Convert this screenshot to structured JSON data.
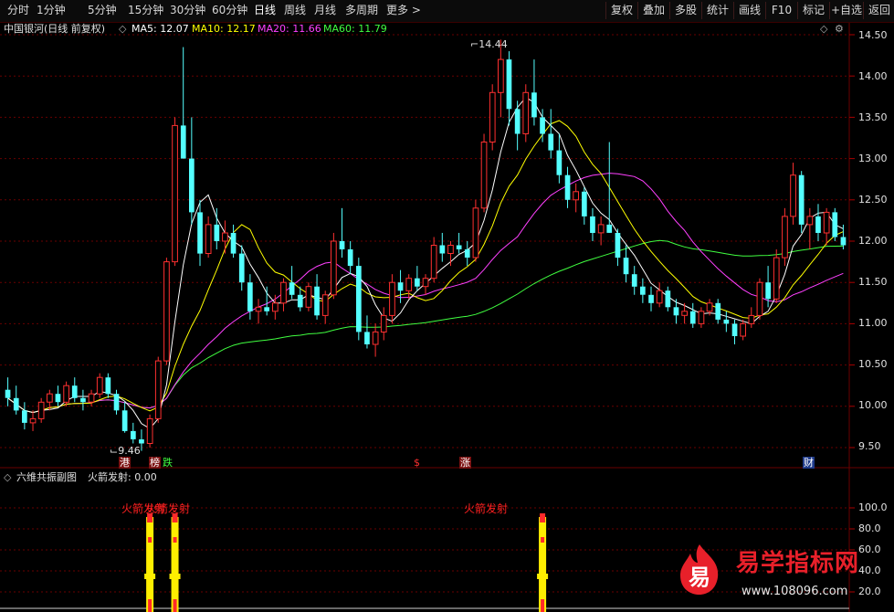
{
  "toolbar": {
    "periods": [
      "分时",
      "1分钟",
      "5分钟",
      "15分钟",
      "30分钟",
      "60分钟",
      "日线",
      "周线",
      "月线",
      "多周期",
      "更多"
    ],
    "active": "日线",
    "right": [
      "复权",
      "叠加",
      "多股",
      "统计",
      "画线",
      "F10",
      "标记",
      "+自选",
      "返回"
    ]
  },
  "main_legend": {
    "stock": "中国银河(日线 前复权)",
    "ma5": "MA5: 12.07",
    "ma10": "MA10: 12.17",
    "ma20": "MA20: 11.66",
    "ma60": "MA60: 11.79"
  },
  "colors": {
    "up": "#ff3030",
    "down": "#54ffff",
    "ma5": "#ffffff",
    "ma10": "#ffff00",
    "ma20": "#ff40ff",
    "ma60": "#40ff40",
    "grid": "#6a0000"
  },
  "price_axis": [
    "14.50",
    "14.00",
    "13.50",
    "13.00",
    "12.50",
    "12.00",
    "11.50",
    "11.00",
    "10.50",
    "10.00",
    "9.50"
  ],
  "sub_axis": [
    "100.0",
    "80.0",
    "60.0",
    "40.0",
    "20.0"
  ],
  "annotations": {
    "high": "14.44",
    "low": "9.46"
  },
  "event_badges": [
    "港",
    "榜",
    "跌",
    "$",
    "涨",
    "财"
  ],
  "sub_legend": {
    "title": "六维共振副图",
    "indicator": "火箭发射: 0.00"
  },
  "rocket_label": "火箭发射",
  "watermark": {
    "glyph": "易",
    "title": "易学指标网",
    "url": "www.108096.com"
  },
  "chart_data": {
    "type": "candlestick",
    "ylim": [
      9.3,
      14.6
    ],
    "ohlc": [
      [
        10.2,
        10.35,
        10.0,
        10.1
      ],
      [
        10.1,
        10.25,
        9.9,
        9.95
      ],
      [
        9.95,
        10.05,
        9.72,
        9.8
      ],
      [
        9.8,
        9.95,
        9.7,
        9.85
      ],
      [
        9.85,
        10.1,
        9.8,
        10.05
      ],
      [
        10.05,
        10.2,
        9.95,
        10.15
      ],
      [
        10.15,
        10.25,
        10.0,
        10.05
      ],
      [
        10.05,
        10.3,
        10.0,
        10.25
      ],
      [
        10.25,
        10.35,
        10.05,
        10.1
      ],
      [
        10.1,
        10.2,
        9.95,
        10.05
      ],
      [
        10.05,
        10.2,
        10.0,
        10.15
      ],
      [
        10.15,
        10.4,
        10.1,
        10.35
      ],
      [
        10.35,
        10.4,
        10.1,
        10.15
      ],
      [
        10.15,
        10.2,
        9.9,
        9.95
      ],
      [
        9.95,
        10.05,
        9.68,
        9.7
      ],
      [
        9.7,
        9.8,
        9.55,
        9.6
      ],
      [
        9.6,
        9.72,
        9.46,
        9.55
      ],
      [
        9.55,
        9.9,
        9.5,
        9.85
      ],
      [
        9.85,
        10.6,
        9.8,
        10.55
      ],
      [
        10.55,
        11.8,
        10.5,
        11.75
      ],
      [
        11.75,
        13.5,
        11.7,
        13.4
      ],
      [
        13.4,
        14.35,
        13.1,
        13.0
      ],
      [
        13.0,
        13.5,
        12.2,
        12.35
      ],
      [
        12.35,
        12.5,
        11.7,
        11.85
      ],
      [
        11.85,
        12.3,
        11.8,
        12.2
      ],
      [
        12.2,
        12.4,
        11.9,
        12.0
      ],
      [
        12.0,
        12.25,
        11.85,
        12.1
      ],
      [
        12.1,
        12.2,
        11.8,
        11.85
      ],
      [
        11.85,
        11.95,
        11.4,
        11.5
      ],
      [
        11.5,
        11.6,
        11.05,
        11.15
      ],
      [
        11.15,
        11.3,
        11.0,
        11.2
      ],
      [
        11.2,
        11.45,
        11.1,
        11.15
      ],
      [
        11.15,
        11.35,
        11.05,
        11.25
      ],
      [
        11.25,
        11.55,
        11.15,
        11.5
      ],
      [
        11.5,
        11.7,
        11.3,
        11.35
      ],
      [
        11.35,
        11.45,
        11.15,
        11.2
      ],
      [
        11.2,
        11.5,
        11.15,
        11.45
      ],
      [
        11.45,
        11.6,
        11.05,
        11.1
      ],
      [
        11.1,
        11.4,
        11.0,
        11.35
      ],
      [
        11.35,
        12.1,
        11.3,
        12.0
      ],
      [
        12.0,
        12.4,
        11.8,
        11.9
      ],
      [
        11.9,
        12.0,
        11.6,
        11.7
      ],
      [
        11.7,
        11.8,
        10.8,
        10.9
      ],
      [
        10.9,
        11.1,
        10.7,
        10.75
      ],
      [
        10.75,
        11.0,
        10.6,
        10.9
      ],
      [
        10.9,
        11.2,
        10.8,
        11.1
      ],
      [
        11.1,
        11.6,
        11.0,
        11.5
      ],
      [
        11.5,
        11.65,
        11.25,
        11.4
      ],
      [
        11.4,
        11.6,
        11.3,
        11.55
      ],
      [
        11.55,
        11.7,
        11.4,
        11.45
      ],
      [
        11.45,
        11.6,
        11.35,
        11.55
      ],
      [
        11.55,
        12.05,
        11.5,
        11.95
      ],
      [
        11.95,
        12.1,
        11.75,
        11.85
      ],
      [
        11.85,
        12.0,
        11.7,
        11.95
      ],
      [
        11.95,
        12.1,
        11.85,
        11.9
      ],
      [
        11.9,
        12.0,
        11.7,
        11.8
      ],
      [
        11.8,
        12.5,
        11.75,
        12.4
      ],
      [
        12.4,
        13.3,
        12.35,
        13.2
      ],
      [
        13.2,
        13.9,
        13.1,
        13.8
      ],
      [
        13.8,
        14.44,
        13.5,
        14.2
      ],
      [
        14.2,
        14.3,
        13.4,
        13.6
      ],
      [
        13.6,
        13.7,
        13.1,
        13.3
      ],
      [
        13.3,
        13.9,
        13.2,
        13.8
      ],
      [
        13.8,
        14.2,
        13.4,
        13.5
      ],
      [
        13.5,
        13.6,
        13.2,
        13.3
      ],
      [
        13.3,
        13.6,
        13.0,
        13.1
      ],
      [
        13.1,
        13.3,
        12.7,
        12.8
      ],
      [
        12.8,
        12.9,
        12.4,
        12.5
      ],
      [
        12.5,
        12.7,
        12.35,
        12.6
      ],
      [
        12.6,
        12.65,
        12.2,
        12.3
      ],
      [
        12.3,
        12.4,
        12.0,
        12.1
      ],
      [
        12.1,
        12.3,
        11.95,
        12.2
      ],
      [
        12.2,
        13.2,
        12.1,
        12.1
      ],
      [
        12.1,
        12.15,
        11.7,
        11.8
      ],
      [
        11.8,
        11.95,
        11.5,
        11.6
      ],
      [
        11.6,
        11.7,
        11.35,
        11.45
      ],
      [
        11.45,
        11.55,
        11.25,
        11.35
      ],
      [
        11.35,
        11.45,
        11.15,
        11.25
      ],
      [
        11.25,
        11.5,
        11.2,
        11.4
      ],
      [
        11.4,
        11.45,
        11.15,
        11.2
      ],
      [
        11.2,
        11.3,
        11.0,
        11.1
      ],
      [
        11.1,
        11.25,
        11.0,
        11.15
      ],
      [
        11.15,
        11.25,
        10.95,
        11.0
      ],
      [
        11.0,
        11.2,
        10.95,
        11.15
      ],
      [
        11.15,
        11.3,
        11.1,
        11.25
      ],
      [
        11.25,
        11.3,
        11.0,
        11.05
      ],
      [
        11.05,
        11.15,
        10.9,
        11.0
      ],
      [
        11.0,
        11.05,
        10.75,
        10.85
      ],
      [
        10.85,
        11.05,
        10.8,
        11.0
      ],
      [
        11.0,
        11.2,
        10.95,
        11.1
      ],
      [
        11.1,
        11.55,
        11.05,
        11.5
      ],
      [
        11.5,
        11.7,
        11.2,
        11.3
      ],
      [
        11.3,
        11.9,
        11.25,
        11.8
      ],
      [
        11.8,
        12.4,
        11.7,
        12.3
      ],
      [
        12.3,
        12.95,
        12.2,
        12.8
      ],
      [
        12.8,
        12.85,
        12.1,
        12.2
      ],
      [
        12.2,
        12.4,
        11.9,
        12.3
      ],
      [
        12.3,
        12.45,
        12.0,
        12.1
      ],
      [
        12.1,
        12.4,
        11.95,
        12.35
      ],
      [
        12.35,
        12.4,
        12.0,
        12.05
      ],
      [
        12.05,
        12.2,
        11.9,
        11.95
      ]
    ],
    "rocket_signals": [
      17,
      20,
      64
    ]
  }
}
